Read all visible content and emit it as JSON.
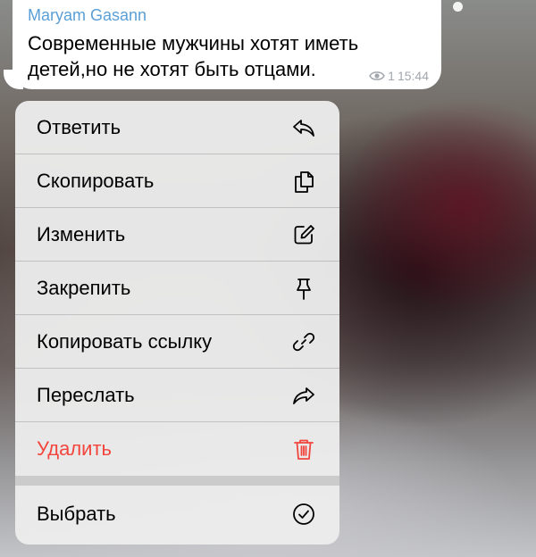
{
  "message": {
    "sender": "Maryam Gasann",
    "text": "Современные мужчины хотят иметь детей,но не хотят быть отцами.",
    "views": "1",
    "time": "15:44"
  },
  "context_menu": {
    "items": [
      {
        "label": "Ответить",
        "icon": "reply-icon"
      },
      {
        "label": "Скопировать",
        "icon": "copy-icon"
      },
      {
        "label": "Изменить",
        "icon": "edit-icon"
      },
      {
        "label": "Закрепить",
        "icon": "pin-icon"
      },
      {
        "label": "Копировать ссылку",
        "icon": "link-icon"
      },
      {
        "label": "Переслать",
        "icon": "forward-icon"
      },
      {
        "label": "Удалить",
        "icon": "trash-icon",
        "color": "#f2453d"
      },
      {
        "label": "Выбрать",
        "icon": "select-check-icon"
      }
    ]
  },
  "colors": {
    "sender_name": "#5a9fd6",
    "danger": "#f2453d",
    "meta": "#a2a7ad"
  }
}
